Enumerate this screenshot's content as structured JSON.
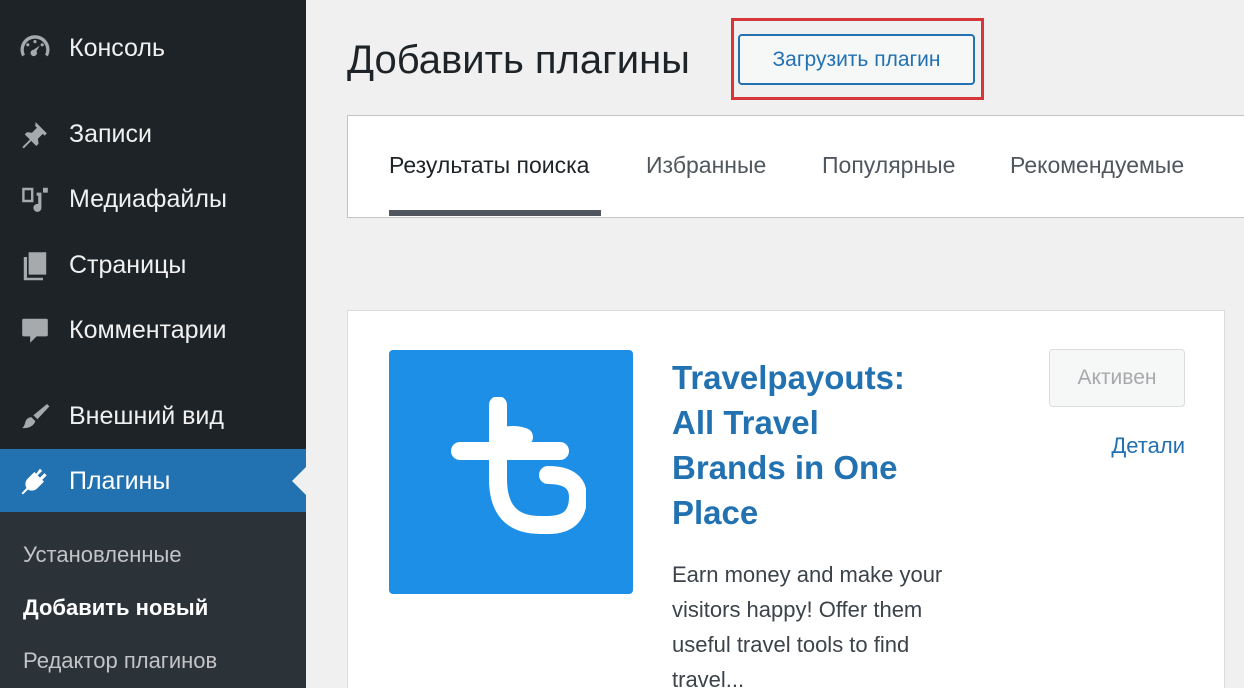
{
  "sidebar": {
    "items": [
      {
        "label": "Консоль",
        "icon": "dashboard-icon"
      },
      {
        "label": "Записи",
        "icon": "pin-icon"
      },
      {
        "label": "Медиафайлы",
        "icon": "media-icon"
      },
      {
        "label": "Страницы",
        "icon": "pages-icon"
      },
      {
        "label": "Комментарии",
        "icon": "comment-icon"
      },
      {
        "label": "Внешний вид",
        "icon": "brush-icon"
      },
      {
        "label": "Плагины",
        "icon": "plugin-icon"
      }
    ],
    "submenu": {
      "installed": "Установленные",
      "add_new": "Добавить новый",
      "editor": "Редактор плагинов"
    }
  },
  "header": {
    "title": "Добавить плагины",
    "upload_label": "Загрузить плагин"
  },
  "tabs": [
    {
      "label": "Результаты поиска"
    },
    {
      "label": "Избранные"
    },
    {
      "label": "Популярные"
    },
    {
      "label": "Рекомендуемые"
    }
  ],
  "plugin": {
    "name": "Travelpayouts: All Travel Brands in One Place",
    "description": "Earn money and make your visitors happy! Offer them useful travel tools to find travel...",
    "status_label": "Активен",
    "details_label": "Детали"
  },
  "colors": {
    "sidebar_bg": "#1d2327",
    "accent": "#2271b1",
    "highlight": "#d63638",
    "logo_bg": "#1d8fe7"
  }
}
